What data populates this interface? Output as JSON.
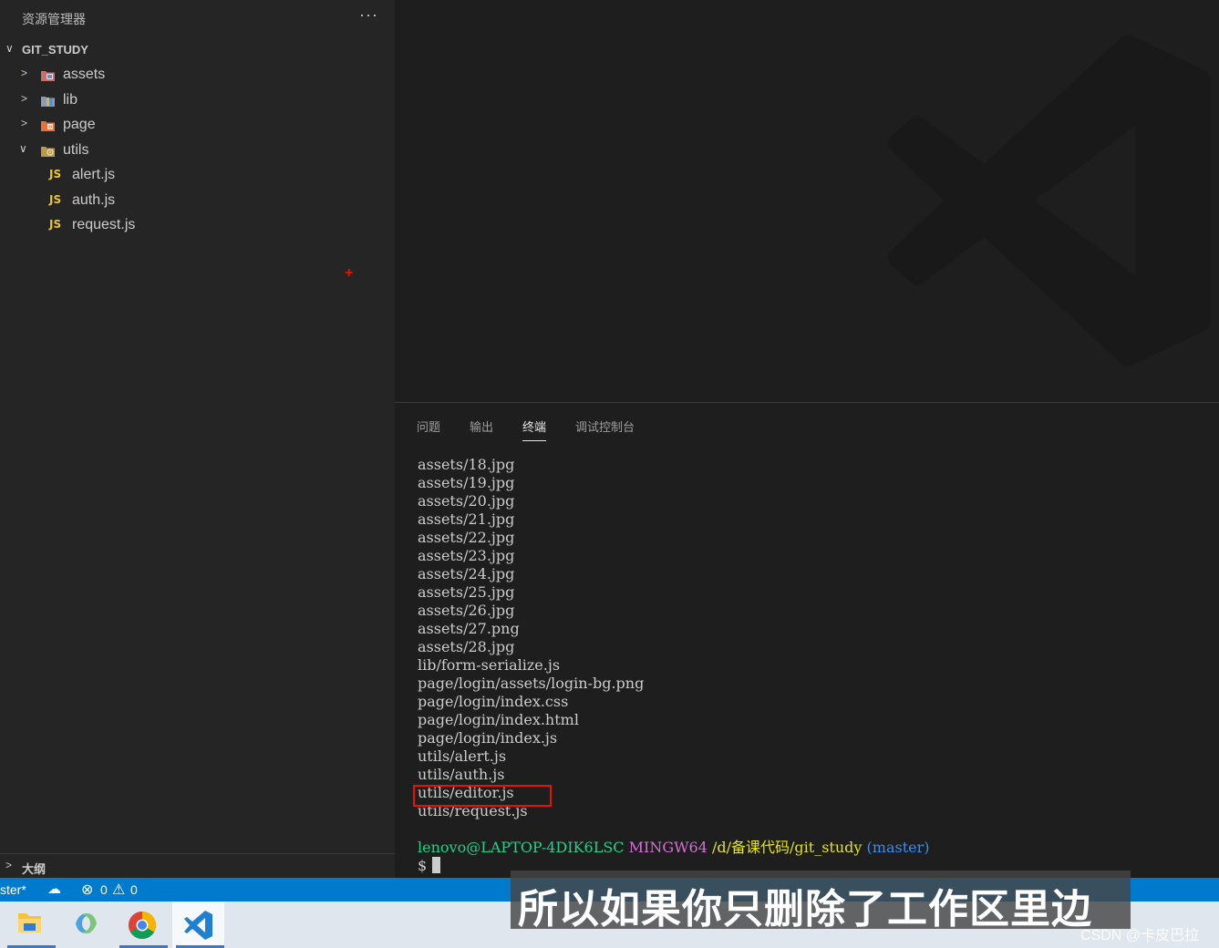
{
  "sidebar": {
    "title": "资源管理器",
    "more": "···",
    "project": "GIT_STUDY",
    "tree": [
      {
        "label": "assets",
        "kind": "folder",
        "expanded": false,
        "icon": "assets-folder-icon"
      },
      {
        "label": "lib",
        "kind": "folder",
        "expanded": false,
        "icon": "lib-folder-icon"
      },
      {
        "label": "page",
        "kind": "folder",
        "expanded": false,
        "icon": "page-folder-icon"
      },
      {
        "label": "utils",
        "kind": "folder",
        "expanded": true,
        "icon": "utils-folder-icon"
      },
      {
        "label": "alert.js",
        "kind": "file",
        "icon": "js-file-icon",
        "badge": "JS"
      },
      {
        "label": "auth.js",
        "kind": "file",
        "icon": "js-file-icon",
        "badge": "JS"
      },
      {
        "label": "request.js",
        "kind": "file",
        "icon": "js-file-icon",
        "badge": "JS"
      }
    ],
    "plus": "+",
    "outline": "大纲"
  },
  "panel": {
    "tabs": [
      {
        "label": "问题",
        "active": false
      },
      {
        "label": "输出",
        "active": false
      },
      {
        "label": "终端",
        "active": true
      },
      {
        "label": "调试控制台",
        "active": false
      }
    ],
    "terminal": {
      "lines": [
        "assets/18.jpg",
        "assets/19.jpg",
        "assets/20.jpg",
        "assets/21.jpg",
        "assets/22.jpg",
        "assets/23.jpg",
        "assets/24.jpg",
        "assets/25.jpg",
        "assets/26.jpg",
        "assets/27.png",
        "assets/28.jpg",
        "lib/form-serialize.js",
        "page/login/assets/login-bg.png",
        "page/login/index.css",
        "page/login/index.html",
        "page/login/index.js",
        "utils/alert.js",
        "utils/auth.js",
        "utils/editor.js",
        "utils/request.js"
      ],
      "prompt": {
        "user_host": "lenovo@LAPTOP-4DIK6LSC",
        "system": "MINGW64",
        "path": "/d/备课代码/git_study",
        "branch": "(master)",
        "symbol": "$"
      }
    }
  },
  "statusbar": {
    "branch": "ster*",
    "errors": "0",
    "warnings": "0"
  },
  "subtitle": "所以如果你只删除了工作区里边",
  "watermark": "CSDN @卡皮巴拉",
  "colors": {
    "statusbar": "#007acc",
    "js_badge": "#e8c531",
    "highlight": "#e51400"
  }
}
